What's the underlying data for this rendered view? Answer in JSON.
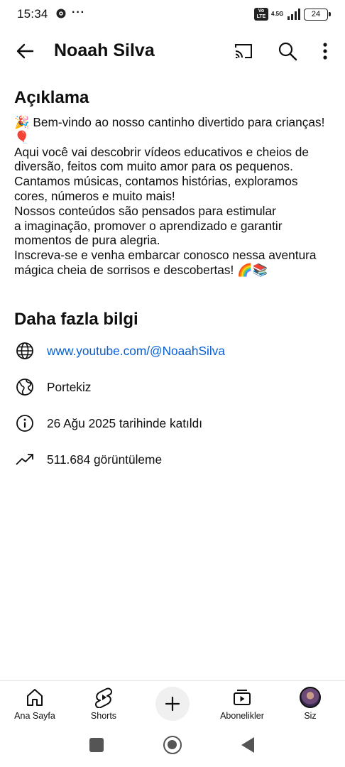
{
  "status_bar": {
    "time": "15:34",
    "dots": "···",
    "volte": "Vo LTE",
    "network": "4.5G",
    "battery": "24"
  },
  "header": {
    "title": "Noaah Silva",
    "icons": [
      "back-arrow-icon",
      "cast-icon",
      "search-icon",
      "more-vert-icon"
    ]
  },
  "description": {
    "heading": "Açıklama",
    "lines": [
      "🎉 Bem-vindo ao nosso cantinho divertido para crianças!",
      "🎈",
      "Aqui você vai descobrir vídeos educativos e cheios de",
      "diversão, feitos com muito amor para os pequenos.",
      "Cantamos músicas, contamos histórias, exploramos",
      "cores, números e muito mais!",
      "Nossos conteúdos são pensados para estimular",
      "a imaginação, promover o aprendizado e garantir",
      "momentos de pura alegria.",
      "Inscreva-se e venha embarcar conosco nessa aventura",
      "mágica cheia de sorrisos e descobertas! 🌈📚"
    ]
  },
  "more_info": {
    "heading": "Daha fazla bilgi",
    "link": "www.youtube.com/@NoaahSilva",
    "country": "Portekiz",
    "joined": "26 Ağu 2025 tarihinde katıldı",
    "views": "511.684 görüntüleme"
  },
  "bottom_nav": {
    "items": [
      {
        "label": "Ana Sayfa",
        "icon": "home-icon"
      },
      {
        "label": "Shorts",
        "icon": "shorts-icon"
      },
      {
        "label": "",
        "icon": "create-plus-icon"
      },
      {
        "label": "Abonelikler",
        "icon": "subscriptions-icon"
      },
      {
        "label": "Siz",
        "icon": "avatar"
      }
    ]
  },
  "colors": {
    "link": "#065fd4",
    "text": "#0f0f0f"
  }
}
